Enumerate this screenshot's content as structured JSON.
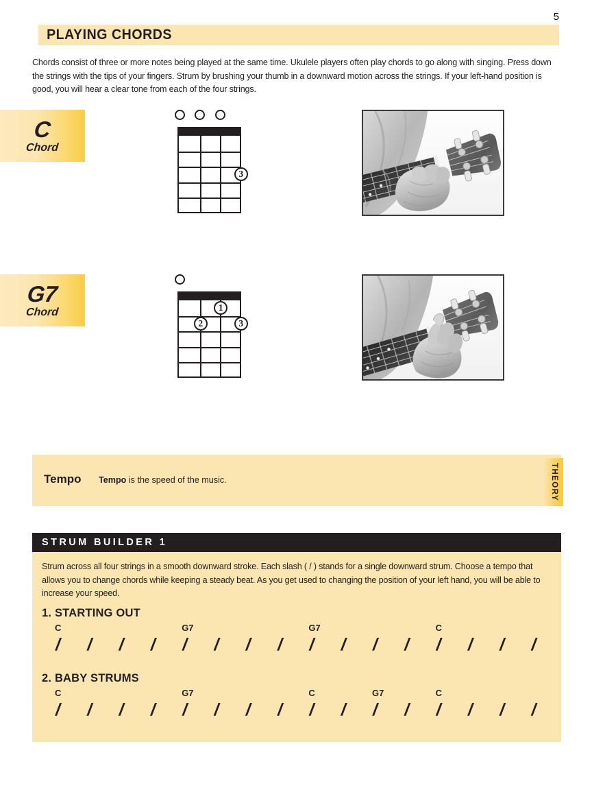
{
  "page": {
    "number": "5",
    "title": "PLAYING CHORDS",
    "intro": "Chords consist of three or more notes being played at the same time. Ukulele players often play chords to go along with singing. Press down the strings with the tips of your fingers. Strum by brushing your thumb in a downward motion across the strings. If your left-hand position is good, you will hear a clear tone from each of the four strings."
  },
  "chords": [
    {
      "name": "C",
      "sub": "Chord",
      "open_strings": [
        1,
        2,
        3
      ],
      "fingers": [
        {
          "label": "3",
          "string": 4,
          "fret": 3
        }
      ],
      "photo_alt": "hand-fretting-c-chord-photo"
    },
    {
      "name": "G7",
      "sub": "Chord",
      "open_strings": [
        1
      ],
      "fingers": [
        {
          "label": "1",
          "string": 3,
          "fret": 1
        },
        {
          "label": "2",
          "string": 2,
          "fret": 2
        },
        {
          "label": "3",
          "string": 4,
          "fret": 2
        }
      ],
      "photo_alt": "hand-fretting-g7-chord-photo"
    }
  ],
  "theory": {
    "tab_label": "THEORY",
    "term": "Tempo",
    "definition_bold": "Tempo",
    "definition_rest": " is the speed of the music."
  },
  "strum_builder": {
    "header": "STRUM BUILDER 1",
    "intro": "Strum across all four strings in a smooth downward stroke. Each slash ( / ) stands for a single downward strum. Choose a tempo that allows you to change chords while keeping a steady beat. As you get used to changing the position of your left hand, you will be able to increase your speed.",
    "exercises": [
      {
        "title": "1. STARTING OUT",
        "slash_count": 16,
        "slash": "/",
        "chord_marks": [
          {
            "label": "C",
            "beat": 1
          },
          {
            "label": "G7",
            "beat": 5
          },
          {
            "label": "G7",
            "beat": 9
          },
          {
            "label": "C",
            "beat": 13
          }
        ]
      },
      {
        "title": "2. BABY STRUMS",
        "slash_count": 16,
        "slash": "/",
        "chord_marks": [
          {
            "label": "C",
            "beat": 1
          },
          {
            "label": "G7",
            "beat": 5
          },
          {
            "label": "C",
            "beat": 9
          },
          {
            "label": "G7",
            "beat": 11
          },
          {
            "label": "C",
            "beat": 13
          }
        ]
      }
    ]
  },
  "colors": {
    "band": "#fbe5b0",
    "gold": "#fbcd45",
    "ink": "#231f20",
    "header_bar": "#231f20"
  }
}
